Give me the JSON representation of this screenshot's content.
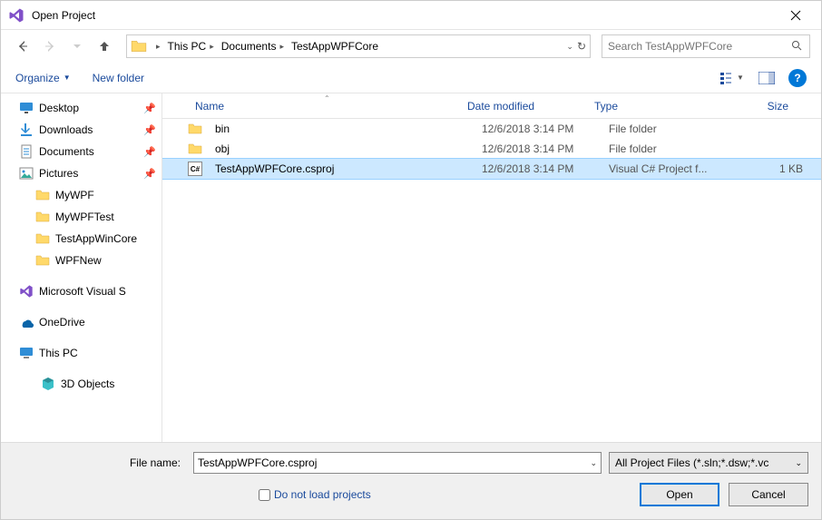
{
  "title": "Open Project",
  "nav": {
    "path": [
      "This PC",
      "Documents",
      "TestAppWPFCore"
    ],
    "search_placeholder": "Search TestAppWPFCore"
  },
  "toolbar": {
    "organize": "Organize",
    "new_folder": "New folder"
  },
  "sidebar": [
    {
      "label": "Desktop",
      "icon": "desktop",
      "pinned": true
    },
    {
      "label": "Downloads",
      "icon": "download",
      "pinned": true
    },
    {
      "label": "Documents",
      "icon": "document",
      "pinned": true
    },
    {
      "label": "Pictures",
      "icon": "pictures",
      "pinned": true
    },
    {
      "label": "MyWPF",
      "icon": "folder",
      "pinned": false,
      "indent": true
    },
    {
      "label": "MyWPFTest",
      "icon": "folder",
      "pinned": false,
      "indent": true
    },
    {
      "label": "TestAppWinCore",
      "icon": "folder",
      "pinned": false,
      "indent": true
    },
    {
      "label": "WPFNew",
      "icon": "folder",
      "pinned": false,
      "indent": true
    }
  ],
  "sidebar2": [
    {
      "label": "Microsoft Visual S",
      "icon": "vs"
    },
    {
      "label": "OneDrive",
      "icon": "onedrive"
    },
    {
      "label": "This PC",
      "icon": "thispc"
    },
    {
      "label": "3D Objects",
      "icon": "3d",
      "indent": true
    }
  ],
  "columns": {
    "name": "Name",
    "date": "Date modified",
    "type": "Type",
    "size": "Size"
  },
  "files": [
    {
      "name": "bin",
      "date": "12/6/2018 3:14 PM",
      "type": "File folder",
      "size": "",
      "icon": "folder",
      "selected": false
    },
    {
      "name": "obj",
      "date": "12/6/2018 3:14 PM",
      "type": "File folder",
      "size": "",
      "icon": "folder",
      "selected": false
    },
    {
      "name": "TestAppWPFCore.csproj",
      "date": "12/6/2018 3:14 PM",
      "type": "Visual C# Project f...",
      "size": "1 KB",
      "icon": "cs",
      "selected": true
    }
  ],
  "footer": {
    "filename_label": "File name:",
    "filename_value": "TestAppWPFCore.csproj",
    "filter": "All Project Files (*.sln;*.dsw;*.vc",
    "checkbox": "Do not load projects",
    "open": "Open",
    "cancel": "Cancel"
  }
}
